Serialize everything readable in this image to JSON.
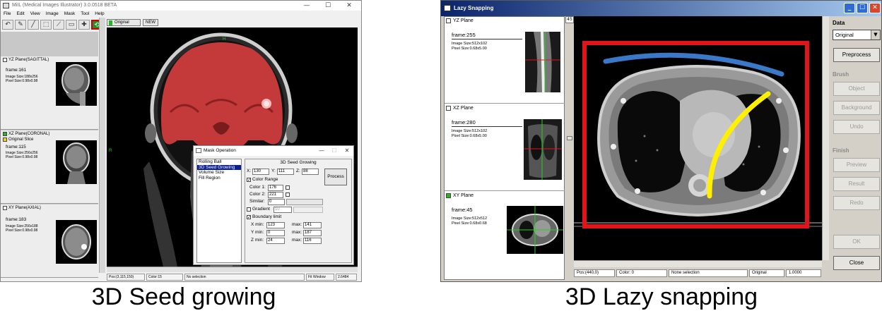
{
  "captions": {
    "left": "3D Seed growing",
    "right": "3D Lazy snapping"
  },
  "mil": {
    "title": "MiIL (Medical Images Illustrator) 3.0.0518 BETA",
    "window_buttons": [
      "—",
      "☐",
      "✕"
    ],
    "menu": [
      "File",
      "Edit",
      "View",
      "Image",
      "Mask",
      "Tool",
      "Help"
    ],
    "toolbar_icons": [
      "undo-icon",
      "pencil-icon",
      "brush-icon",
      "select-rect-icon",
      "wand-icon",
      "rect-icon",
      "cross-icon",
      "refresh-icon"
    ],
    "view_tabs": {
      "original": "Original",
      "new": "NEW"
    },
    "planes": [
      {
        "title": "YZ Plane(SAGITTAL)",
        "frame": "frame:161",
        "size": "Image Size:188x256",
        "pixel": "Pixel Size:0.98x0.98",
        "checked": false
      },
      {
        "title": "XZ Plane(CORONAL)",
        "sub": "Original Slice",
        "frame": "frame:115",
        "size": "Image Size:256x256",
        "pixel": "Pixel Size:0.98x0.98",
        "checked": true
      },
      {
        "title": "XY Plane(AXIAL)",
        "frame": "frame:183",
        "size": "Image Size:256x188",
        "pixel": "Pixel Size:0.98x0.98",
        "checked": false
      }
    ],
    "orientation": {
      "top": "H",
      "left": "R"
    },
    "status": {
      "pos": "Pos:(3,115,150)",
      "color": "Color:15",
      "selection": "No selection",
      "fit": "Fit Window",
      "zoom": "2.6484"
    }
  },
  "mask_dialog": {
    "title": "Mask Operation",
    "operations": [
      "Rolling Ball",
      "3D Seed Growing",
      "Volume Size",
      "Fill Region"
    ],
    "selected_index": 1,
    "panel_title": "3D Seed Growing",
    "x_label": "X:",
    "x": "130",
    "y_label": "Y:",
    "y": "111",
    "z_label": "Z:",
    "z": "88",
    "process": "Process",
    "color_range": "Color Range",
    "color1_label": "Color 1:",
    "color1": "176",
    "color2_label": "Color 2:",
    "color2": "221",
    "similar_label": "Similar:",
    "similar": "0",
    "gradient_label": "Gradient",
    "gradient": "10",
    "boundary_label": "Boundary limit",
    "xmin_label": "X  min:",
    "xmin": "123",
    "xmax_label": "max:",
    "xmax": "141",
    "ymin_label": "Y  min:",
    "ymin": "0",
    "ymax_label": "max:",
    "ymax": "187",
    "zmin_label": "Z  min:",
    "zmin": "24",
    "zmax_label": "max:",
    "zmax": "116"
  },
  "lazy": {
    "title": "Lazy Snapping",
    "planes": [
      {
        "title": "YZ Plane",
        "frame": "frame:255",
        "size": "Image Size:512x102",
        "pixel": "Pixel Size:0.68x5.00",
        "checked": false
      },
      {
        "title": "XZ Plane",
        "frame": "frame:280",
        "size": "Image Size:512x102",
        "pixel": "Pixel Size:0.68x5.00",
        "checked": false
      },
      {
        "title": "XY Plane",
        "frame": "frame:45",
        "size": "Image Size:512x512",
        "pixel": "Pixel Size:0.68x0.68",
        "checked": true
      }
    ],
    "corner_label": "45",
    "status": {
      "pos": "Pos:(440,0)",
      "color": "Color: 0",
      "selection": "None selection",
      "view": "Original",
      "zoom": "1.0000"
    },
    "side": {
      "data_label": "Data",
      "data_select": "Original",
      "preprocess": "Preprocess",
      "brush_label": "Brush",
      "object": "Object",
      "background": "Background",
      "undo": "Undo",
      "finish_label": "Finish",
      "preview": "Preview",
      "result": "Result",
      "redo": "Redo",
      "ok": "OK",
      "close": "Close"
    },
    "colors": {
      "box": "#e0141b",
      "background_stroke": "#3a78c8",
      "object_stroke": "#ffef00"
    }
  },
  "colors": {
    "mask_overlay": "#e03030",
    "title_active": "#0a246a",
    "list_selected": "#0b1f8f",
    "crosshair": "#27d027"
  }
}
